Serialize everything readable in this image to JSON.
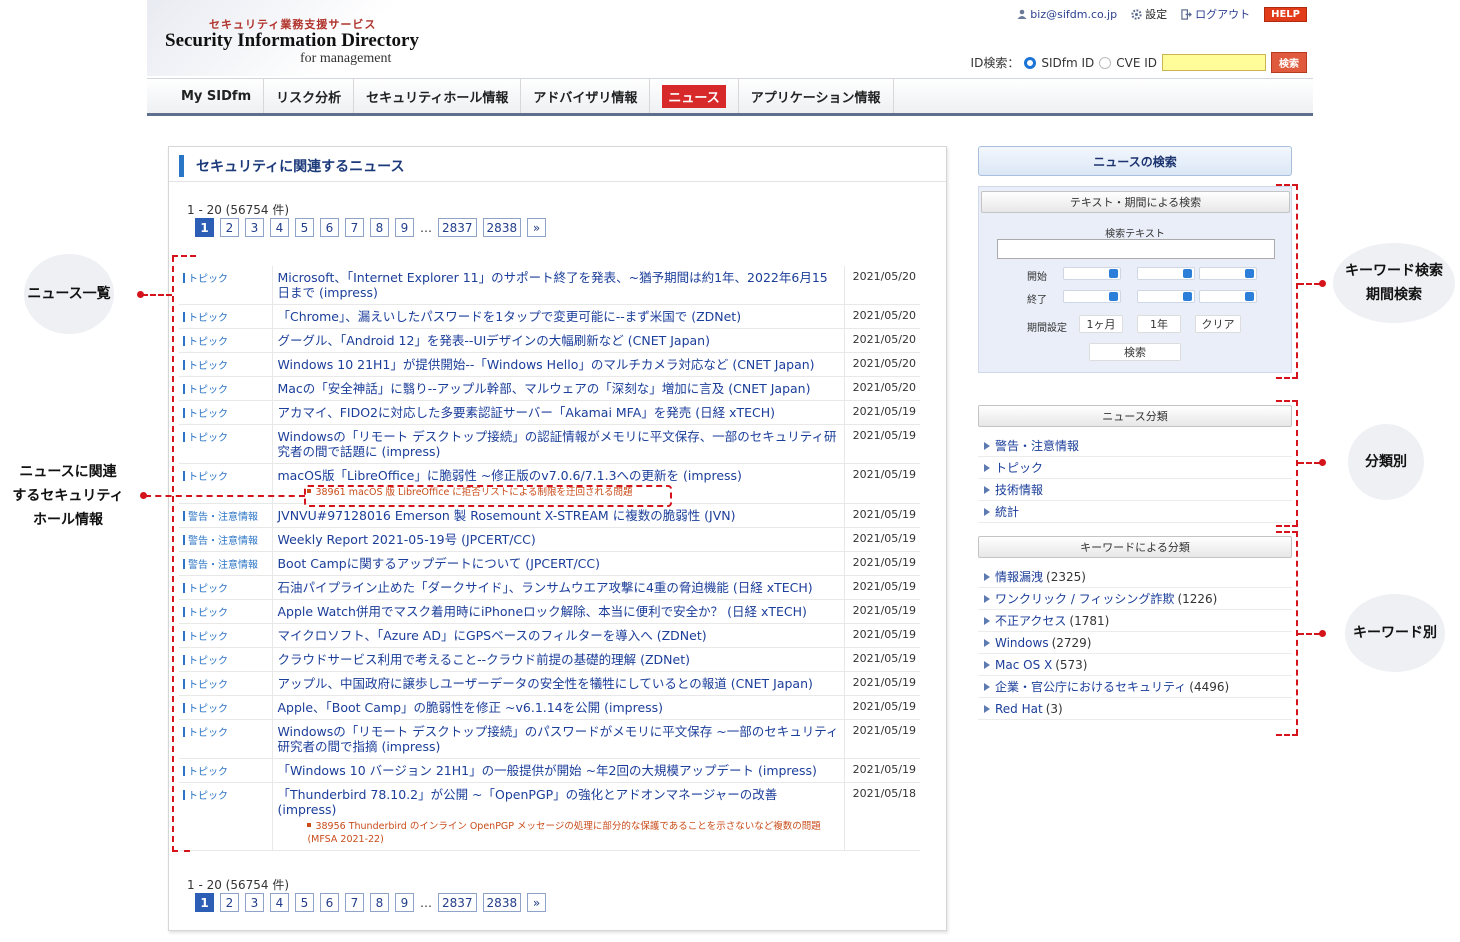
{
  "header": {
    "logo_sub": "セキュリティ業務支援サービス",
    "logo_main": "Security Information Directory",
    "logo_tag": "for management",
    "user_email": "biz@sifdm.co.jp",
    "settings_label": "設定",
    "logout_label": "ログアウト",
    "help_label": "HELP",
    "id_search_label": "ID検索：",
    "id_option_sidfm": "SIDfm ID",
    "id_option_cve": "CVE ID",
    "id_search_value": "",
    "id_search_button": "検索"
  },
  "nav": {
    "items": [
      {
        "label": "My SIDfm",
        "active": false
      },
      {
        "label": "リスク分析",
        "active": false
      },
      {
        "label": "セキュリティホール情報",
        "active": false
      },
      {
        "label": "アドバイザリ情報",
        "active": false
      },
      {
        "label": "ニュース",
        "active": true
      },
      {
        "label": "アプリケーション情報",
        "active": false
      }
    ]
  },
  "main": {
    "title": "セキュリティに関連するニュース",
    "count_text": "1 - 20 (56754 件)",
    "pages": [
      "1",
      "2",
      "3",
      "4",
      "5",
      "6",
      "7",
      "8",
      "9",
      "…",
      "2837",
      "2838",
      "»"
    ],
    "news": [
      {
        "category": "トピック",
        "title": "Microsoft、「Internet Explorer 11」のサポート終了を発表、~猶予期間は約1年、2022年6月15日まで (impress)",
        "date": "2021/05/20"
      },
      {
        "category": "トピック",
        "title": "「Chrome」、漏えいしたパスワードを1タップで変更可能に--まず米国で (ZDNet)",
        "date": "2021/05/20"
      },
      {
        "category": "トピック",
        "title": "グーグル、「Android 12」を発表--UIデザインの大幅刷新など (CNET Japan)",
        "date": "2021/05/20"
      },
      {
        "category": "トピック",
        "title": "Windows 10 21H1」が提供開始--「Windows Hello」のマルチカメラ対応など (CNET Japan)",
        "date": "2021/05/20"
      },
      {
        "category": "トピック",
        "title": "Macの「安全神話」に翳り--アップル幹部、マルウェアの「深刻な」増加に言及 (CNET Japan)",
        "date": "2021/05/20"
      },
      {
        "category": "トピック",
        "title": "アカマイ、FIDO2に対応した多要素認証サーバー「Akamai MFA」を発売 (日経 xTECH)",
        "date": "2021/05/19"
      },
      {
        "category": "トピック",
        "title": "Windowsの「リモート デスクトップ接続」の認証情報がメモリに平文保存、一部のセキュリティ研究者の間で話題に (impress)",
        "date": "2021/05/19"
      },
      {
        "category": "トピック",
        "title": "macOS版「LibreOffice」に脆弱性 ~修正版のv7.0.6/7.1.3への更新を (impress)",
        "date": "2021/05/19",
        "sub": "38961 macOS 版 LibreOffice に拒否リストによる制限を迂回される問題"
      },
      {
        "category": "警告・注意情報",
        "title": "JVNVU#97128016 Emerson 製 Rosemount X-STREAM に複数の脆弱性 (JVN)",
        "date": "2021/05/19"
      },
      {
        "category": "警告・注意情報",
        "title": "Weekly Report 2021-05-19号 (JPCERT/CC)",
        "date": "2021/05/19"
      },
      {
        "category": "警告・注意情報",
        "title": "Boot Campに関するアップデートについて (JPCERT/CC)",
        "date": "2021/05/19"
      },
      {
        "category": "トピック",
        "title": "石油パイプライン止めた「ダークサイド」、ランサムウエア攻撃に4重の脅迫機能 (日経 xTECH)",
        "date": "2021/05/19"
      },
      {
        "category": "トピック",
        "title": "Apple Watch併用でマスク着用時にiPhoneロック解除、本当に便利で安全か？ (日経 xTECH)",
        "date": "2021/05/19"
      },
      {
        "category": "トピック",
        "title": "マイクロソフト、「Azure AD」にGPSベースのフィルターを導入へ (ZDNet)",
        "date": "2021/05/19"
      },
      {
        "category": "トピック",
        "title": "クラウドサービス利用で考えること--クラウド前提の基礎的理解 (ZDNet)",
        "date": "2021/05/19"
      },
      {
        "category": "トピック",
        "title": "アップル、中国政府に譲歩しユーザーデータの安全性を犠牲にしているとの報道 (CNET Japan)",
        "date": "2021/05/19"
      },
      {
        "category": "トピック",
        "title": "Apple、「Boot Camp」の脆弱性を修正 ~v6.1.14を公開 (impress)",
        "date": "2021/05/19"
      },
      {
        "category": "トピック",
        "title": "Windowsの「リモート デスクトップ接続」のパスワードがメモリに平文保存 ~一部のセキュリティ研究者の間で指摘 (impress)",
        "date": "2021/05/19"
      },
      {
        "category": "トピック",
        "title": "「Windows 10 バージョン 21H1」の一般提供が開始 ~年2回の大規模アップデート (impress)",
        "date": "2021/05/19"
      },
      {
        "category": "トピック",
        "title": "「Thunderbird 78.10.2」が公開 ~「OpenPGP」の強化とアドオンマネージャーの改善 (impress)",
        "date": "2021/05/18",
        "sub": "38956 Thunderbird のインライン OpenPGP メッセージの処理に部分的な保護であることを示さないなど複数の問題 (MFSA 2021-22)"
      }
    ]
  },
  "sidebar": {
    "header": "ニュースの検索",
    "text_search_title": "テキスト・期間による検索",
    "search_text_label": "検索テキスト",
    "search_text_value": "",
    "start_label": "開始",
    "end_label": "終了",
    "period_label": "期間設定",
    "btn_1month": "1ヶ月",
    "btn_1year": "1年",
    "btn_clear": "クリア",
    "btn_search": "検索",
    "category_title": "ニュース分類",
    "categories": [
      "警告・注意情報",
      "トピック",
      "技術情報",
      "統計"
    ],
    "keyword_title": "キーワードによる分類",
    "keywords": [
      {
        "label": "情報漏洩",
        "count": "(2325)"
      },
      {
        "label": "ワンクリック / フィッシング詐欺",
        "count": "(1226)"
      },
      {
        "label": "不正アクセス",
        "count": "(1781)"
      },
      {
        "label": "Windows",
        "count": "(2729)"
      },
      {
        "label": "Mac OS X",
        "count": "(573)"
      },
      {
        "label": "企業・官公庁におけるセキュリティ",
        "count": "(4496)"
      },
      {
        "label": "Red Hat",
        "count": "(3)"
      }
    ]
  },
  "annotations": {
    "news_list": "ニュース一覧",
    "related_line1": "ニュースに関連",
    "related_line2": "するセキュリティ",
    "related_line3": "ホール情報",
    "keyword_search_line1": "キーワード検索",
    "keyword_search_line2": "期間検索",
    "by_category": "分類別",
    "by_keyword": "キーワード別"
  },
  "colors": {
    "accent_red": "#d8292a",
    "link_blue": "#1b3e9a",
    "annotation_red": "#d4131a"
  }
}
